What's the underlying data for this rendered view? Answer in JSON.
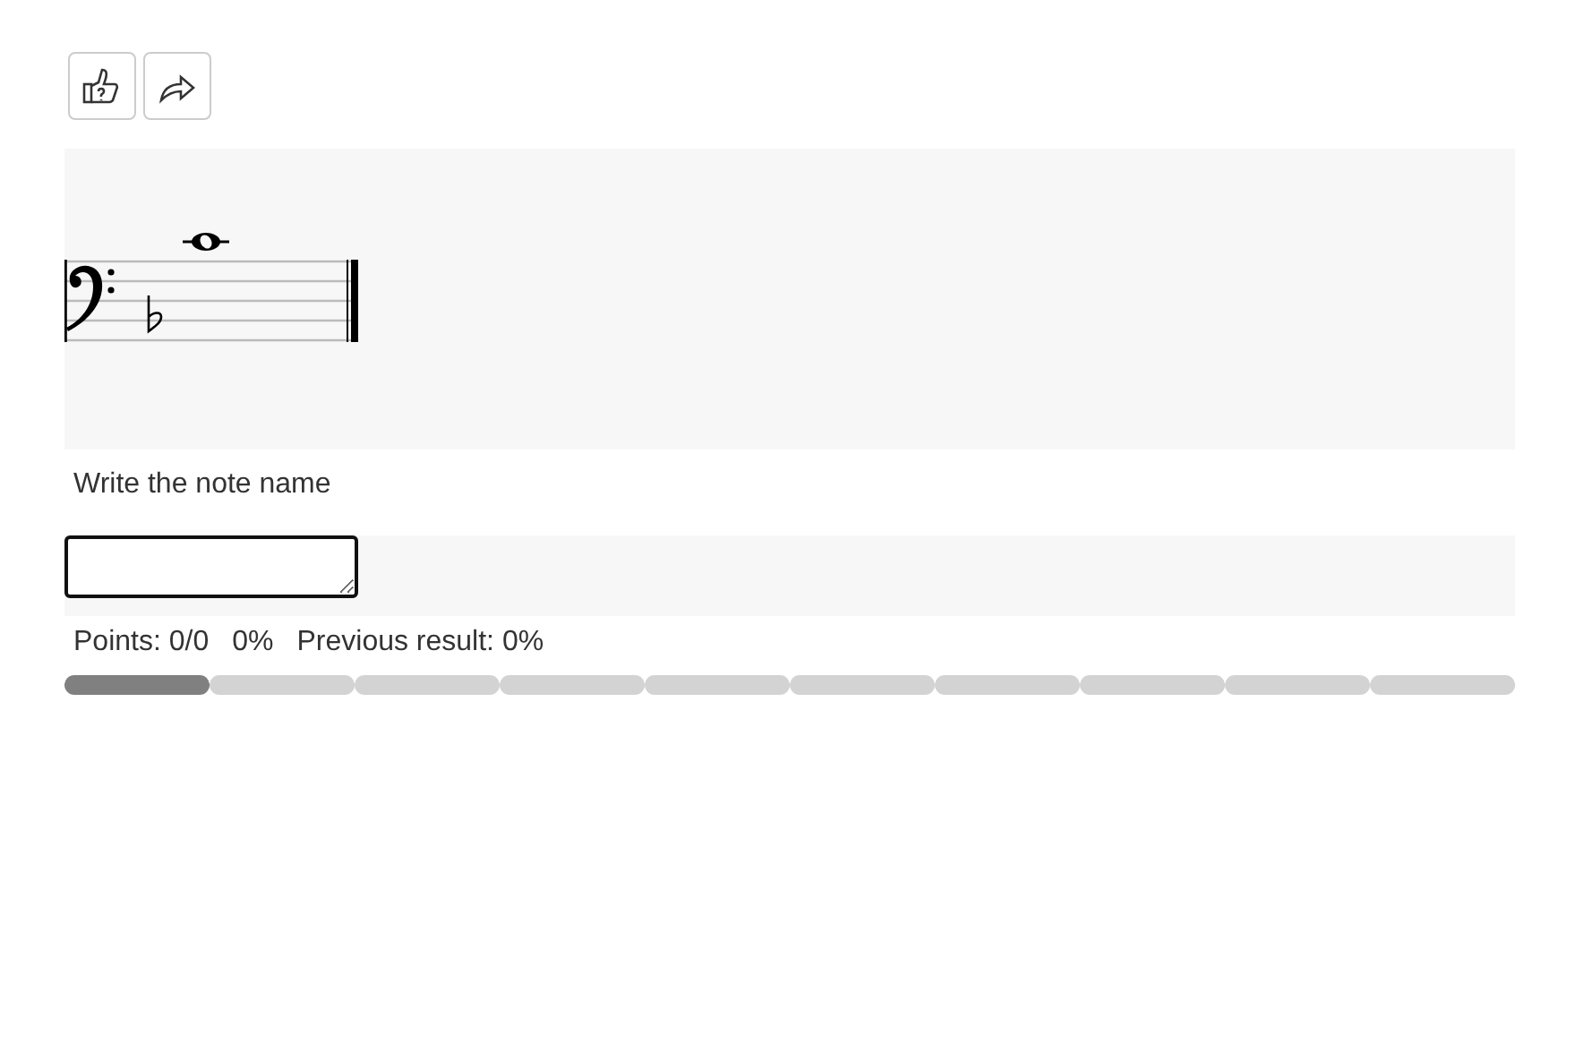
{
  "question": {
    "prompt": "Write the note name"
  },
  "score": {
    "points": "Points: 0/0",
    "percent": "0%",
    "previous": "Previous result: 0%"
  },
  "progress": [
    {
      "current": true
    },
    {
      "current": false
    },
    {
      "current": false
    },
    {
      "current": false
    },
    {
      "current": false
    },
    {
      "current": false
    },
    {
      "current": false
    },
    {
      "current": false
    },
    {
      "current": false
    },
    {
      "current": false
    }
  ]
}
